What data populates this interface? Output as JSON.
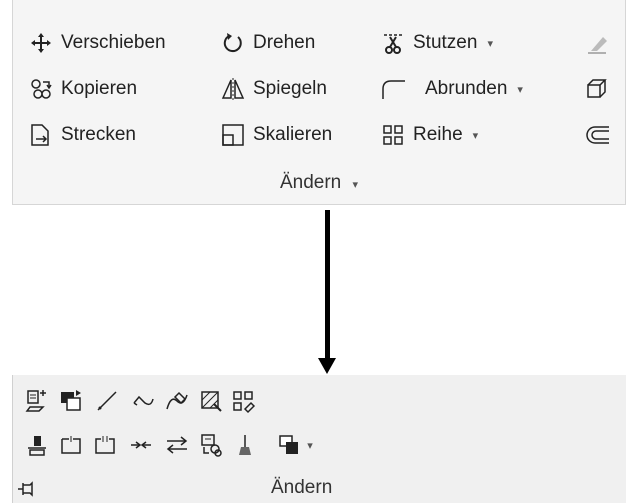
{
  "ribbon": {
    "buttons": {
      "move": "Verschieben",
      "rotate": "Drehen",
      "trim": "Stutzen",
      "copy": "Kopieren",
      "mirror": "Spiegeln",
      "fillet": "Abrunden",
      "stretch": "Strecken",
      "scale": "Skalieren",
      "array": "Reihe"
    },
    "panel_title": "Ändern",
    "dropdown_glyph": "▾"
  },
  "compact_panel": {
    "panel_title": "Ändern",
    "dropdown_glyph": "▾"
  },
  "arrow_color": "#000000"
}
